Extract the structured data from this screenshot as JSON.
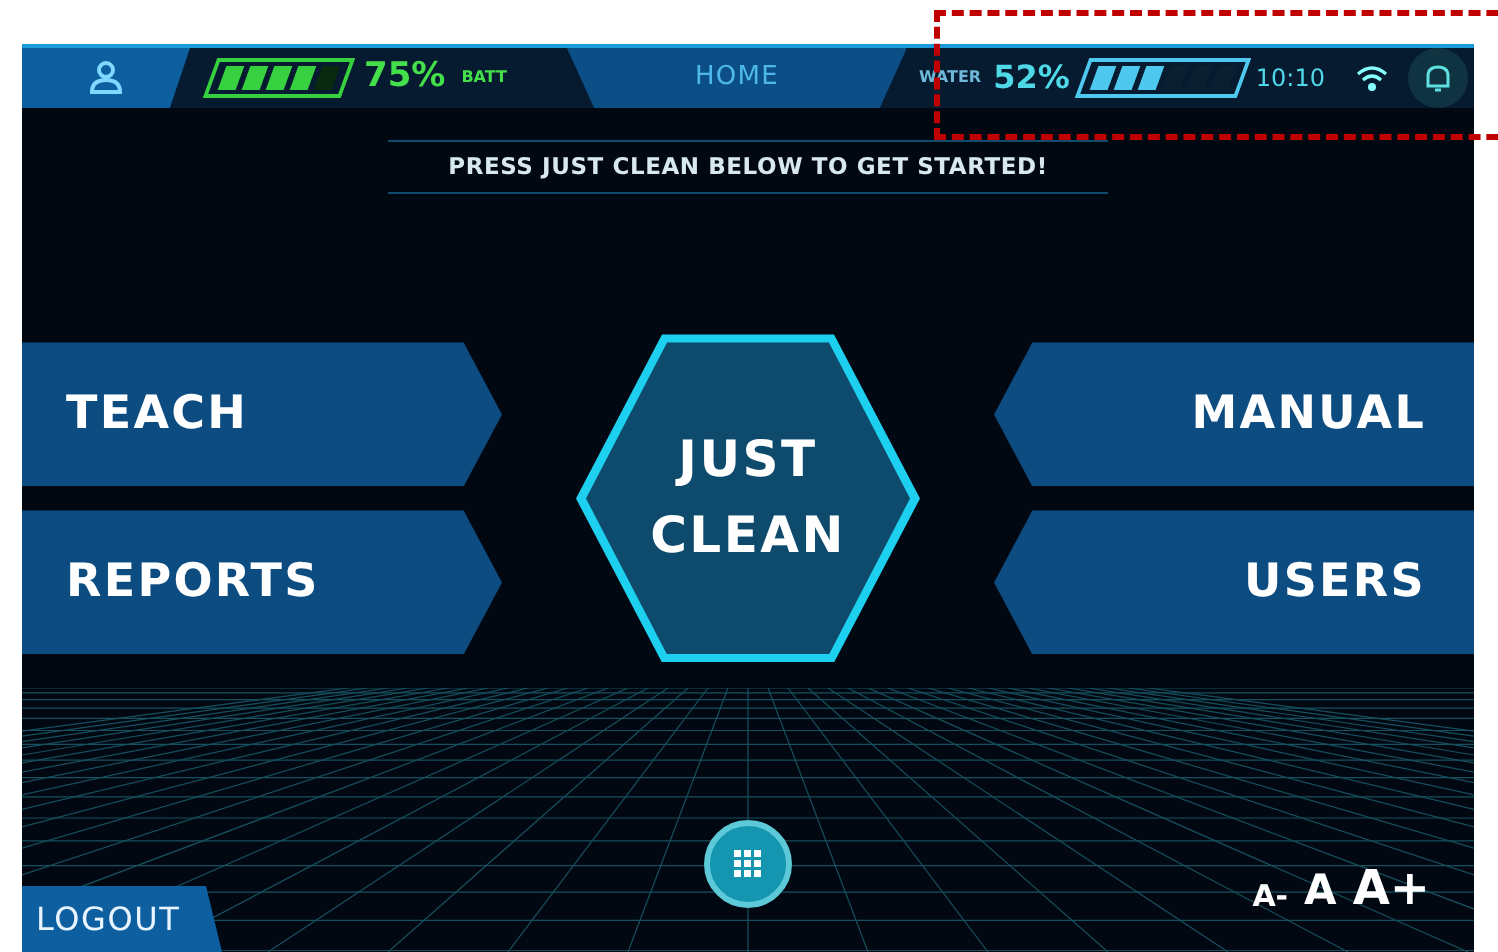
{
  "top_bar": {
    "battery": {
      "level": 0.75,
      "value": "75%",
      "label": "BATT"
    },
    "title": "HOME",
    "water": {
      "label": "WATER",
      "value": "52%",
      "level": 0.52
    },
    "time": "10:10"
  },
  "hint": "PRESS JUST CLEAN BELOW TO GET STARTED!",
  "left_buttons": [
    "TEACH",
    "REPORTS"
  ],
  "right_buttons": [
    "MANUAL",
    "USERS"
  ],
  "main_button": "JUST CLEAN",
  "logout": "LOGOUT",
  "font_sizes": [
    "A-",
    "A",
    "A+"
  ]
}
